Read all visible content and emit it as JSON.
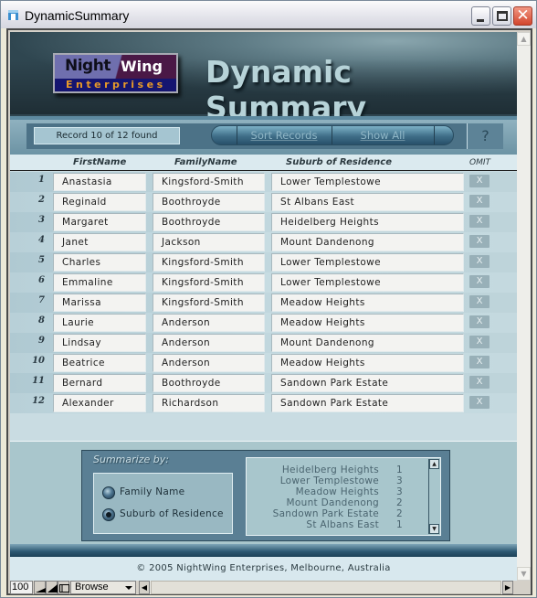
{
  "window": {
    "title": "DynamicSummary",
    "controls": {
      "minimize": "_",
      "maximize": "□",
      "close": "✕"
    }
  },
  "header": {
    "logo": {
      "night": "Night",
      "wing": "Wing",
      "enterprises": "Enterprises"
    },
    "title": "Dynamic Summary"
  },
  "toolbar": {
    "record_status": "Record 10 of 12 found",
    "sort_label": "Sort Records",
    "show_all_label": "Show All",
    "help_label": "?"
  },
  "table": {
    "columns": [
      "FirstName",
      "FamilyName",
      "Suburb of Residence",
      "OMIT"
    ],
    "omit_label": "X",
    "current_record": 10,
    "rows": [
      {
        "num": "1",
        "first": "Anastasia",
        "family": "Kingsford-Smith",
        "suburb": "Lower Templestowe"
      },
      {
        "num": "2",
        "first": "Reginald",
        "family": "Boothroyde",
        "suburb": "St Albans East"
      },
      {
        "num": "3",
        "first": "Margaret",
        "family": "Boothroyde",
        "suburb": "Heidelberg Heights"
      },
      {
        "num": "4",
        "first": "Janet",
        "family": "Jackson",
        "suburb": "Mount Dandenong"
      },
      {
        "num": "5",
        "first": "Charles",
        "family": "Kingsford-Smith",
        "suburb": "Lower Templestowe"
      },
      {
        "num": "6",
        "first": "Emmaline",
        "family": "Kingsford-Smith",
        "suburb": "Lower Templestowe"
      },
      {
        "num": "7",
        "first": "Marissa",
        "family": "Kingsford-Smith",
        "suburb": "Meadow Heights"
      },
      {
        "num": "8",
        "first": "Laurie",
        "family": "Anderson",
        "suburb": "Meadow Heights"
      },
      {
        "num": "9",
        "first": "Lindsay",
        "family": "Anderson",
        "suburb": "Mount Dandenong"
      },
      {
        "num": "10",
        "first": "Beatrice",
        "family": "Anderson",
        "suburb": "Meadow Heights"
      },
      {
        "num": "11",
        "first": "Bernard",
        "family": "Boothroyde",
        "suburb": "Sandown Park Estate"
      },
      {
        "num": "12",
        "first": "Alexander",
        "family": "Richardson",
        "suburb": "Sandown Park Estate"
      }
    ]
  },
  "summary": {
    "label": "Summarize by:",
    "options": [
      {
        "label": "Family Name",
        "selected": false
      },
      {
        "label": "Suburb of Residence",
        "selected": true
      }
    ],
    "results": [
      {
        "name": "Heidelberg Heights",
        "count": "1"
      },
      {
        "name": "Lower Templestowe",
        "count": "3"
      },
      {
        "name": "Meadow Heights",
        "count": "3"
      },
      {
        "name": "Mount Dandenong",
        "count": "2"
      },
      {
        "name": "Sandown Park Estate",
        "count": "2"
      },
      {
        "name": "St Albans East",
        "count": "1"
      }
    ]
  },
  "footer": {
    "copyright": "© 2005 NightWing Enterprises, Melbourne, Australia"
  },
  "statusbar": {
    "zoom": "100",
    "mode": "Browse"
  }
}
